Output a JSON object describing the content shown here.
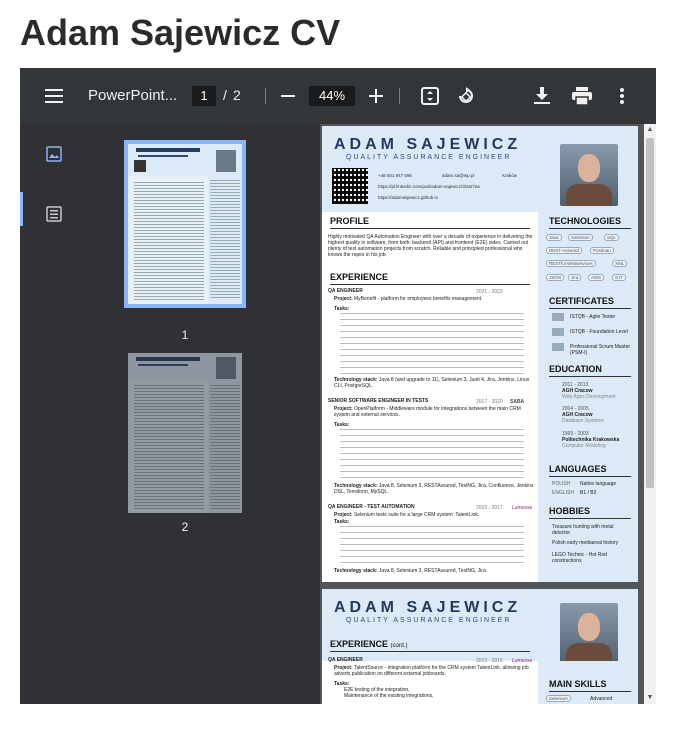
{
  "page": {
    "title": "Adam Sajewicz CV"
  },
  "toolbar": {
    "doc_title": "PowerPoint...",
    "current_page": "1",
    "page_separator": "/",
    "total_pages": "2",
    "zoom": "44%",
    "icons": [
      "menu-icon",
      "zoom-out-icon",
      "zoom-in-icon",
      "fit-page-icon",
      "rotate-icon",
      "download-icon",
      "print-icon",
      "more-icon"
    ]
  },
  "sidebar": {
    "tabs": [
      "thumbnails-icon",
      "outline-icon"
    ],
    "thumbnails": [
      {
        "label": "1",
        "selected": true
      },
      {
        "label": "2",
        "selected": false
      }
    ]
  },
  "cv": {
    "name": "ADAM SAJEWICZ",
    "role": "QUALITY ASSURANCE ENGINEER",
    "contact": {
      "phone": "+48 601 947 596",
      "email": "adam.sa@wp.pl",
      "location": "Kraków",
      "linkedin": "https://pl.linkedin.com/pub/adam-sajewicz/3/3a/7ea",
      "github": "https://adamsajewicz.github.io"
    },
    "profile_heading": "PROFILE",
    "profile_text": "Highly motivated QA Automation Engineer with over a decade of experience in delivering the highest quality in software, from both: backend (API) and frontend (E2E) sides. Carried out plenty of test automation projects from scratch. Reliable and principled professional who knows the ropes in his job.",
    "experience_heading": "EXPERIENCE",
    "experience_cont_heading": "EXPERIENCE",
    "experience_cont_suffix": "(cont.)",
    "jobs": [
      {
        "title": "QA ENGINEER",
        "dates": "2021 - 2023",
        "project": "MyBenefit - platform for employees benefits management.",
        "stack": "Java 8 (and upgrade to 11), Selenium 3, Junit 4, Jira, Jenkins, Linux CLI, PostgreSQL."
      },
      {
        "title": "SENIOR SOFTWARE ENGINEER IN TESTS",
        "dates": "2017 - 2020",
        "company": "SABA",
        "project": "OpenPlatform - Middleware module for integrations between the main CRM system and external services.",
        "stack": "Java 8, Selenium 3, RESTAssured, TestNG, Jira, Confluence, Jenkins DSL, Terraform, MySQL."
      },
      {
        "title": "QA ENGINEER - TEST AUTOMATION",
        "dates": "2015 - 2017",
        "company": "Lumesse",
        "project": "Selenium tests suite for a large CRM system: TalentLink.",
        "stack": "Java 8, Selenium 3, RESTAssured, TestNG, Jira."
      },
      {
        "title": "QA ENGINEER",
        "dates": "2013 - 2015",
        "company": "Lumesse",
        "project": "TalentSource - integration platform for the CRM system TalentLink, allowing job adverts publication on different external jobboards.",
        "tasks_heading": "Tasks:",
        "tasks": [
          "E2E testing of the integration,",
          "Maintenance of the existing integrations,"
        ]
      }
    ],
    "labels": {
      "project": "Project:",
      "tasks": "Tasks:",
      "stack": "Technology stack:"
    },
    "technologies_heading": "TECHNOLOGIES",
    "technologies": [
      "Java",
      "Selenium",
      "SQL",
      "REST-Assured",
      "Postman",
      "RESTful Webservices",
      "XML",
      "JSON",
      "Jira",
      "AWS",
      "GIT"
    ],
    "certificates_heading": "CERTIFICATES",
    "certificates": [
      "ISTQB - Agile Tester",
      "ISTQB - Foundation Level",
      "Professional Scrum Master (PSM-I)"
    ],
    "education_heading": "EDUCATION",
    "education": [
      {
        "years": "2011 - 2013",
        "school": "AGH Cracow",
        "field": "Web Apps Development"
      },
      {
        "years": "2004 - 2005",
        "school": "AGH Cracow",
        "field": "Database Systems"
      },
      {
        "years": "1999 - 2003",
        "school": "Politechnika Krakowska",
        "field": "Computer Modeling"
      }
    ],
    "languages_heading": "LANGUAGES",
    "languages": [
      {
        "lang": "POLISH",
        "level": "Native language"
      },
      {
        "lang": "ENGLISH",
        "level": "B1 / B2"
      }
    ],
    "hobbies_heading": "HOBBIES",
    "hobbies": [
      "Treasure hunting with metal detector",
      "Polish early mediaeval history",
      "LEGO Technic - Hot Rod constructions"
    ],
    "main_skills_heading": "MAIN SKILLS",
    "main_skills": [
      {
        "skill": "Selenium",
        "level": "Advanced"
      }
    ]
  },
  "colors": {
    "toolbar": "#323639",
    "sidebar": "#2f3134",
    "doc_bg": "#525659",
    "cv_accent": "#dce9f7",
    "selected_thumb": "#8ab4f8"
  }
}
